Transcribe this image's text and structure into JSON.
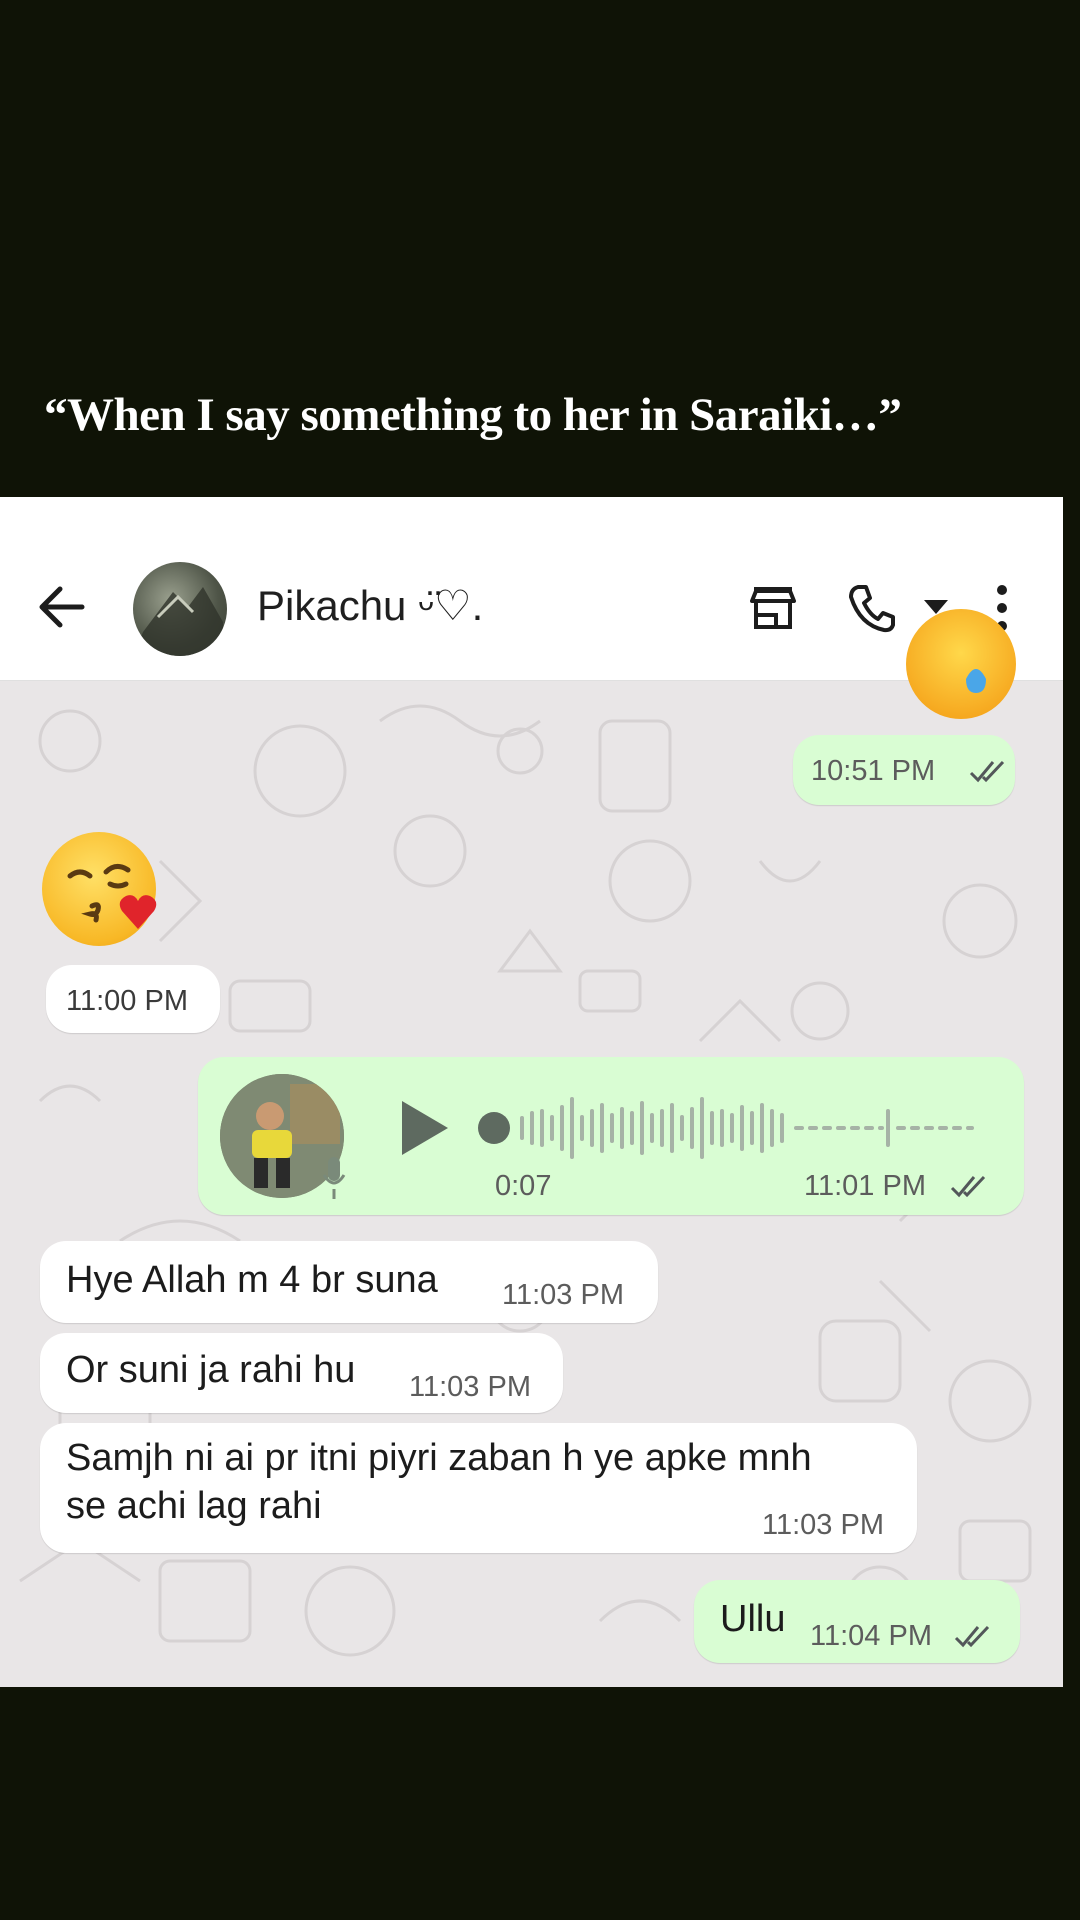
{
  "caption": "“When I say something to her in Saraiki…”",
  "header": {
    "contact_name": "Pikachu ᵕ̈♡.",
    "icons": [
      "back-arrow-icon",
      "store-icon",
      "call-icon",
      "dropdown-icon",
      "more-vert-icon"
    ]
  },
  "messages": [
    {
      "id": "m1",
      "direction": "out",
      "time": "10:51 PM",
      "status": "read"
    },
    {
      "id": "m2",
      "direction": "in",
      "emoji": "kissing-winking-heart-emoji",
      "time": "11:00 PM"
    },
    {
      "id": "m3",
      "direction": "out",
      "type": "voice",
      "duration": "0:07",
      "time": "11:01 PM",
      "status": "read"
    },
    {
      "id": "m4",
      "direction": "in",
      "text": "Hye Allah m 4 br suna",
      "time": "11:03 PM"
    },
    {
      "id": "m5",
      "direction": "in",
      "text": "Or suni ja rahi hu",
      "time": "11:03 PM"
    },
    {
      "id": "m6",
      "direction": "in",
      "text_line1": "Samjh ni ai pr itni piyri zaban h ye apke mnh",
      "text_line2": "se achi lag rahi",
      "time": "11:03 PM"
    },
    {
      "id": "m7",
      "direction": "out",
      "text": "Ullu",
      "time": "11:04 PM",
      "status": "read"
    }
  ],
  "colors": {
    "outgoing_bubble": "#d9fdd3",
    "incoming_bubble": "#ffffff",
    "tick_read": "#53575a",
    "backdrop": "#0f1306"
  }
}
